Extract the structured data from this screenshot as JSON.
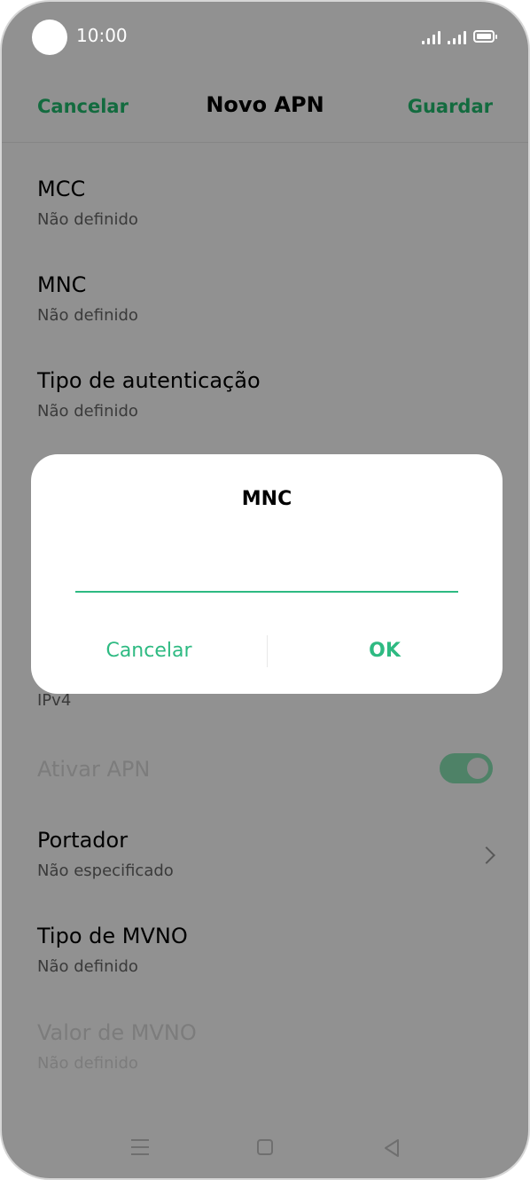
{
  "status_bar": {
    "time": "10:00",
    "icons": [
      "signal-icon",
      "signal-icon",
      "battery-icon"
    ]
  },
  "header": {
    "cancel_label": "Cancelar",
    "title": "Novo APN",
    "save_label": "Guardar"
  },
  "items": [
    {
      "title": "MCC",
      "value": "Não definido"
    },
    {
      "title": "MNC",
      "value": "Não definido"
    },
    {
      "title": "Tipo de autenticação",
      "value": "Não definido"
    },
    {
      "title": "",
      "value": "IPv4"
    },
    {
      "title": "Ativar APN",
      "toggle_on": true
    },
    {
      "title": "Portador",
      "value": "Não especificado"
    },
    {
      "title": "Tipo de MVNO",
      "value": "Não definido"
    },
    {
      "title": "Valor de MVNO",
      "value": "Não definido"
    }
  ],
  "dialog": {
    "title": "MNC",
    "input_value": "",
    "cancel_label": "Cancelar",
    "ok_label": "OK"
  },
  "colors": {
    "accent": "#2eba82",
    "header_accent": "#136b3f",
    "overlay": "#919191",
    "dialog_bg": "#ffffff"
  },
  "navbar": {
    "icons": [
      "menu-icon",
      "home-icon",
      "back-icon"
    ]
  }
}
